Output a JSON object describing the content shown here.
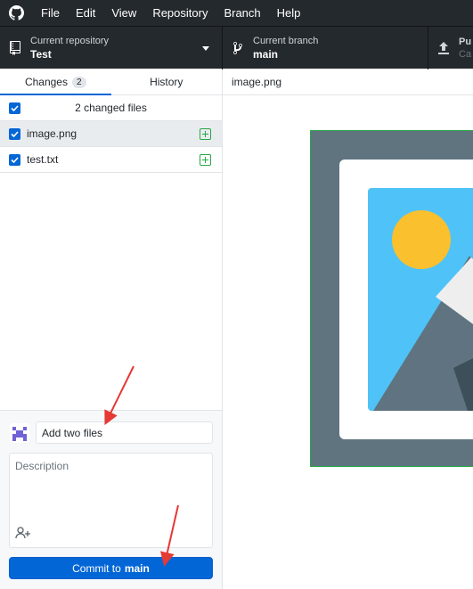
{
  "menu": {
    "items": [
      "File",
      "Edit",
      "View",
      "Repository",
      "Branch",
      "Help"
    ]
  },
  "toolbar": {
    "repo_label": "Current repository",
    "repo_name": "Test",
    "branch_label": "Current branch",
    "branch_name": "main",
    "push_title": "Pu",
    "push_sub": "Ca"
  },
  "tabs": {
    "changes_label": "Changes",
    "changes_count": "2",
    "history_label": "History"
  },
  "changes": {
    "summary": "2 changed files",
    "files": [
      {
        "name": "image.png",
        "status": "added"
      },
      {
        "name": "test.txt",
        "status": "added"
      }
    ]
  },
  "commit": {
    "summary_value": "Add two files",
    "description_placeholder": "Description",
    "button_prefix": "Commit to",
    "button_branch": "main"
  },
  "diff": {
    "file_path": "image.png"
  },
  "colors": {
    "accent": "#0366d6",
    "added": "#28a745",
    "annotation": "#e53935"
  }
}
